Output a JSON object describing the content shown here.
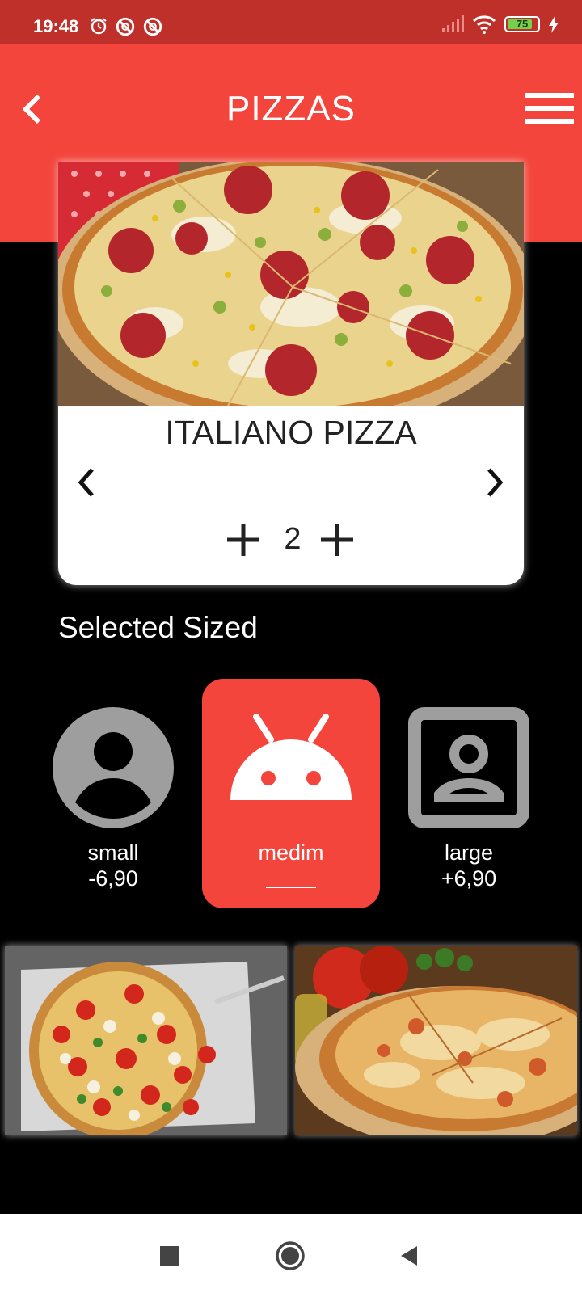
{
  "status_bar": {
    "time": "19:48",
    "battery_level": "75",
    "icons_left": [
      "alarm-icon",
      "blocked-notification-icon",
      "blocked-notification-icon"
    ],
    "icons_right": [
      "signal-icon",
      "wifi-icon",
      "battery-icon",
      "charging-icon"
    ]
  },
  "header": {
    "title": "PIZZAS",
    "back_icon": "chevron-left-icon",
    "menu_icon": "hamburger-menu-icon",
    "background": "#f3453b"
  },
  "product": {
    "name": "ITALIANO PIZZA",
    "image": "pepperoni-pizza-image",
    "quantity": "2",
    "prev_icon": "chevron-left-icon",
    "next_icon": "chevron-right-icon",
    "decrement_icon": "plus-icon",
    "increment_icon": "plus-icon"
  },
  "sizes": {
    "title": "Selected Sized",
    "options": [
      {
        "label": "small",
        "price": "-6,90",
        "icon": "account-circle-icon",
        "selected": false
      },
      {
        "label": "medim",
        "price": "",
        "icon": "android-icon",
        "selected": true
      },
      {
        "label": "large",
        "price": "+6,90",
        "icon": "contact-portrait-icon",
        "selected": false
      }
    ],
    "selected_color": "#f3453b"
  },
  "gallery": [
    {
      "image": "margherita-pizza-image"
    },
    {
      "image": "cheese-pizza-image"
    }
  ],
  "nav_bar": {
    "buttons": [
      "recents-square-icon",
      "home-circle-icon",
      "back-triangle-icon"
    ]
  }
}
